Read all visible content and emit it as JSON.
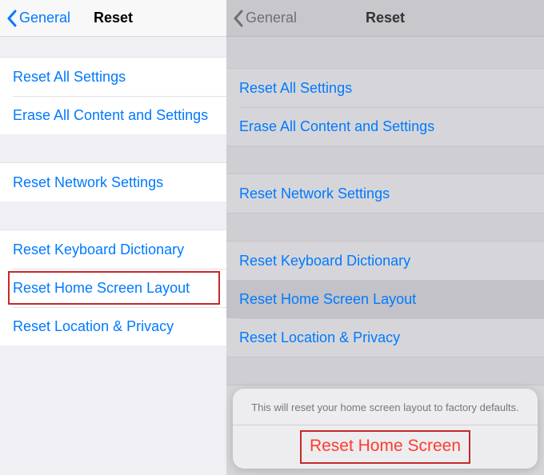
{
  "left": {
    "nav": {
      "back": "General",
      "title": "Reset"
    },
    "items": {
      "reset_all": "Reset All Settings",
      "erase_all": "Erase All Content and Settings",
      "network": "Reset Network Settings",
      "keyboard": "Reset Keyboard Dictionary",
      "home": "Reset Home Screen Layout",
      "location": "Reset Location & Privacy"
    }
  },
  "right": {
    "nav": {
      "back": "General",
      "title": "Reset"
    },
    "items": {
      "reset_all": "Reset All Settings",
      "erase_all": "Erase All Content and Settings",
      "network": "Reset Network Settings",
      "keyboard": "Reset Keyboard Dictionary",
      "home": "Reset Home Screen Layout",
      "location": "Reset Location & Privacy"
    },
    "sheet": {
      "message": "This will reset your home screen layout to factory defaults.",
      "confirm": "Reset Home Screen"
    }
  }
}
